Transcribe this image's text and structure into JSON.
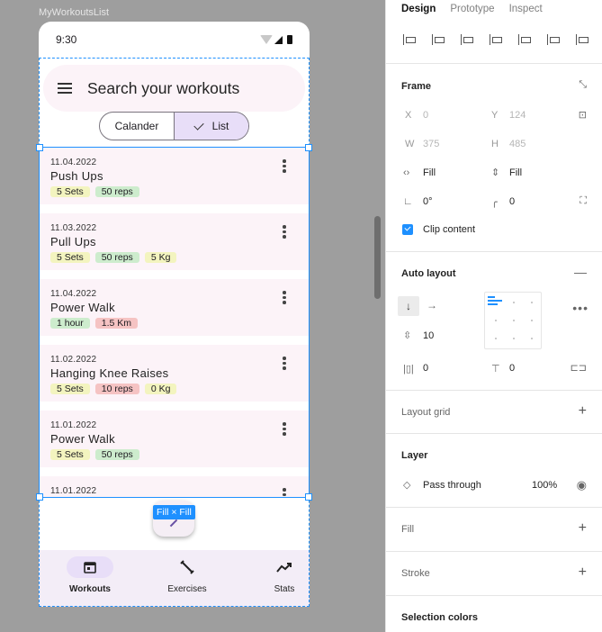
{
  "frame_label": "MyWorkoutsList",
  "status": {
    "time": "9:30"
  },
  "search": {
    "placeholder_text": "Search your workouts"
  },
  "toggle": {
    "calendar": "Calander",
    "list": "List"
  },
  "workouts": [
    {
      "date": "11.04.2022",
      "name": "Push Ups",
      "tags": [
        {
          "text": "5 Sets",
          "color": "yellow"
        },
        {
          "text": "50 reps",
          "color": "green"
        }
      ]
    },
    {
      "date": "11.03.2022",
      "name": "Pull Ups",
      "tags": [
        {
          "text": "5 Sets",
          "color": "yellow"
        },
        {
          "text": "50 reps",
          "color": "green"
        },
        {
          "text": "5 Kg",
          "color": "yellow"
        }
      ]
    },
    {
      "date": "11.04.2022",
      "name": "Power Walk",
      "tags": [
        {
          "text": "1 hour",
          "color": "green"
        },
        {
          "text": "1.5 Km",
          "color": "red"
        }
      ]
    },
    {
      "date": "11.02.2022",
      "name": "Hanging Knee Raises",
      "tags": [
        {
          "text": "5 Sets",
          "color": "yellow"
        },
        {
          "text": "10 reps",
          "color": "red"
        },
        {
          "text": "0 Kg",
          "color": "yellow"
        }
      ]
    },
    {
      "date": "11.01.2022",
      "name": "Power Walk",
      "tags": [
        {
          "text": "5 Sets",
          "color": "yellow"
        },
        {
          "text": "50 reps",
          "color": "green"
        }
      ]
    },
    {
      "date": "11.01.2022",
      "name": "",
      "tags": []
    }
  ],
  "fill_badge": "Fill × Fill",
  "nav": {
    "workouts": "Workouts",
    "exercises": "Exercises",
    "stats": "Stats"
  },
  "panel": {
    "tabs": [
      "Design",
      "Prototype",
      "Inspect"
    ],
    "frame": {
      "title": "Frame",
      "x_label": "X",
      "x": "0",
      "y_label": "Y",
      "y": "124",
      "w_label": "W",
      "w": "375",
      "h_label": "H",
      "h": "485",
      "fill_h": "Fill",
      "fill_v": "Fill",
      "rotation": "0°",
      "radius": "0",
      "clip": "Clip content"
    },
    "auto_layout": {
      "title": "Auto layout",
      "spacing": "10",
      "pad_h": "0",
      "pad_v": "0"
    },
    "layout_grid": "Layout grid",
    "layer": {
      "title": "Layer",
      "blend": "Pass through",
      "opacity": "100%"
    },
    "fill": "Fill",
    "stroke": "Stroke",
    "selection_colors": "Selection colors"
  }
}
